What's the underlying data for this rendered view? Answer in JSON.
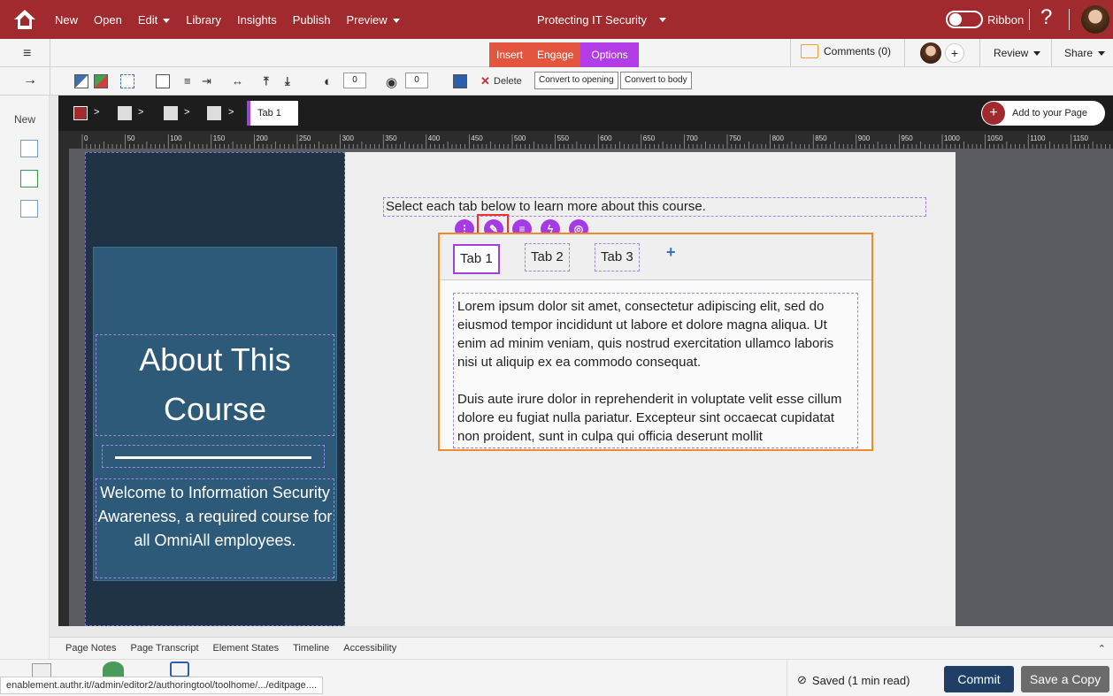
{
  "topbar": {
    "menu": [
      "New",
      "Open",
      "Edit",
      "Library",
      "Insights",
      "Publish",
      "Preview"
    ],
    "title": "Protecting IT Security",
    "ribbon": "Ribbon",
    "help": "?"
  },
  "subbar": {
    "tabs": [
      "Insert",
      "Engage",
      "Options"
    ],
    "comments": "Comments (0)",
    "plus": "+",
    "review": "Review",
    "share": "Share"
  },
  "toolbar": {
    "num1": "0",
    "num2": "0",
    "delete": "Delete",
    "convert_opening": "Convert to opening",
    "convert_body": "Convert to body"
  },
  "sidebar": {
    "new_label": "New"
  },
  "breadcrumb": {
    "tab_chip": "Tab 1",
    "add_label": "Add to your Page",
    "add_plus": "+"
  },
  "ruler": {
    "labels": [
      "0",
      "50",
      "100",
      "150",
      "200",
      "250",
      "300",
      "350",
      "400",
      "450",
      "500",
      "550",
      "600",
      "650",
      "700",
      "750",
      "800",
      "850",
      "900",
      "950",
      "1000",
      "1050",
      "1100",
      "1150"
    ]
  },
  "page": {
    "heading_line1": "About This",
    "heading_line2": "Course",
    "welcome": "Welcome to Information Security Awareness, a required course for all OmniAll employees.",
    "instruction": "Select each tab below to learn more about this course.",
    "tabs": [
      "Tab 1",
      "Tab 2",
      "Tab 3"
    ],
    "add_tab": "+",
    "content_p1": "Lorem ipsum dolor sit amet, consectetur adipiscing elit, sed do eiusmod tempor incididunt ut labore et dolore magna aliqua. Ut enim ad minim veniam, quis nostrud exercitation ullamco laboris nisi ut aliquip ex ea commodo consequat.",
    "content_p2": "Duis aute irure dolor in reprehenderit in voluptate velit esse cillum dolore eu fugiat nulla pariatur. Excepteur sint occaecat cupidatat non proident, sunt in culpa qui officia deserunt mollit"
  },
  "bottom_tabs": [
    "Page Notes",
    "Page Transcript",
    "Element States",
    "Timeline",
    "Accessibility"
  ],
  "footer": {
    "url": "enablement.authr.it//admin/editor2/authoringtool/toolhome/.../editpage....",
    "saved": "Saved (1 min read)",
    "commit": "Commit",
    "save_copy": "Save a Copy"
  },
  "colors": {
    "brand": "#a12a2e",
    "options_tab": "#b23ce6",
    "insert_tab": "#e3553f",
    "commit": "#1f3f66",
    "tab_border": "#f08a2a"
  }
}
